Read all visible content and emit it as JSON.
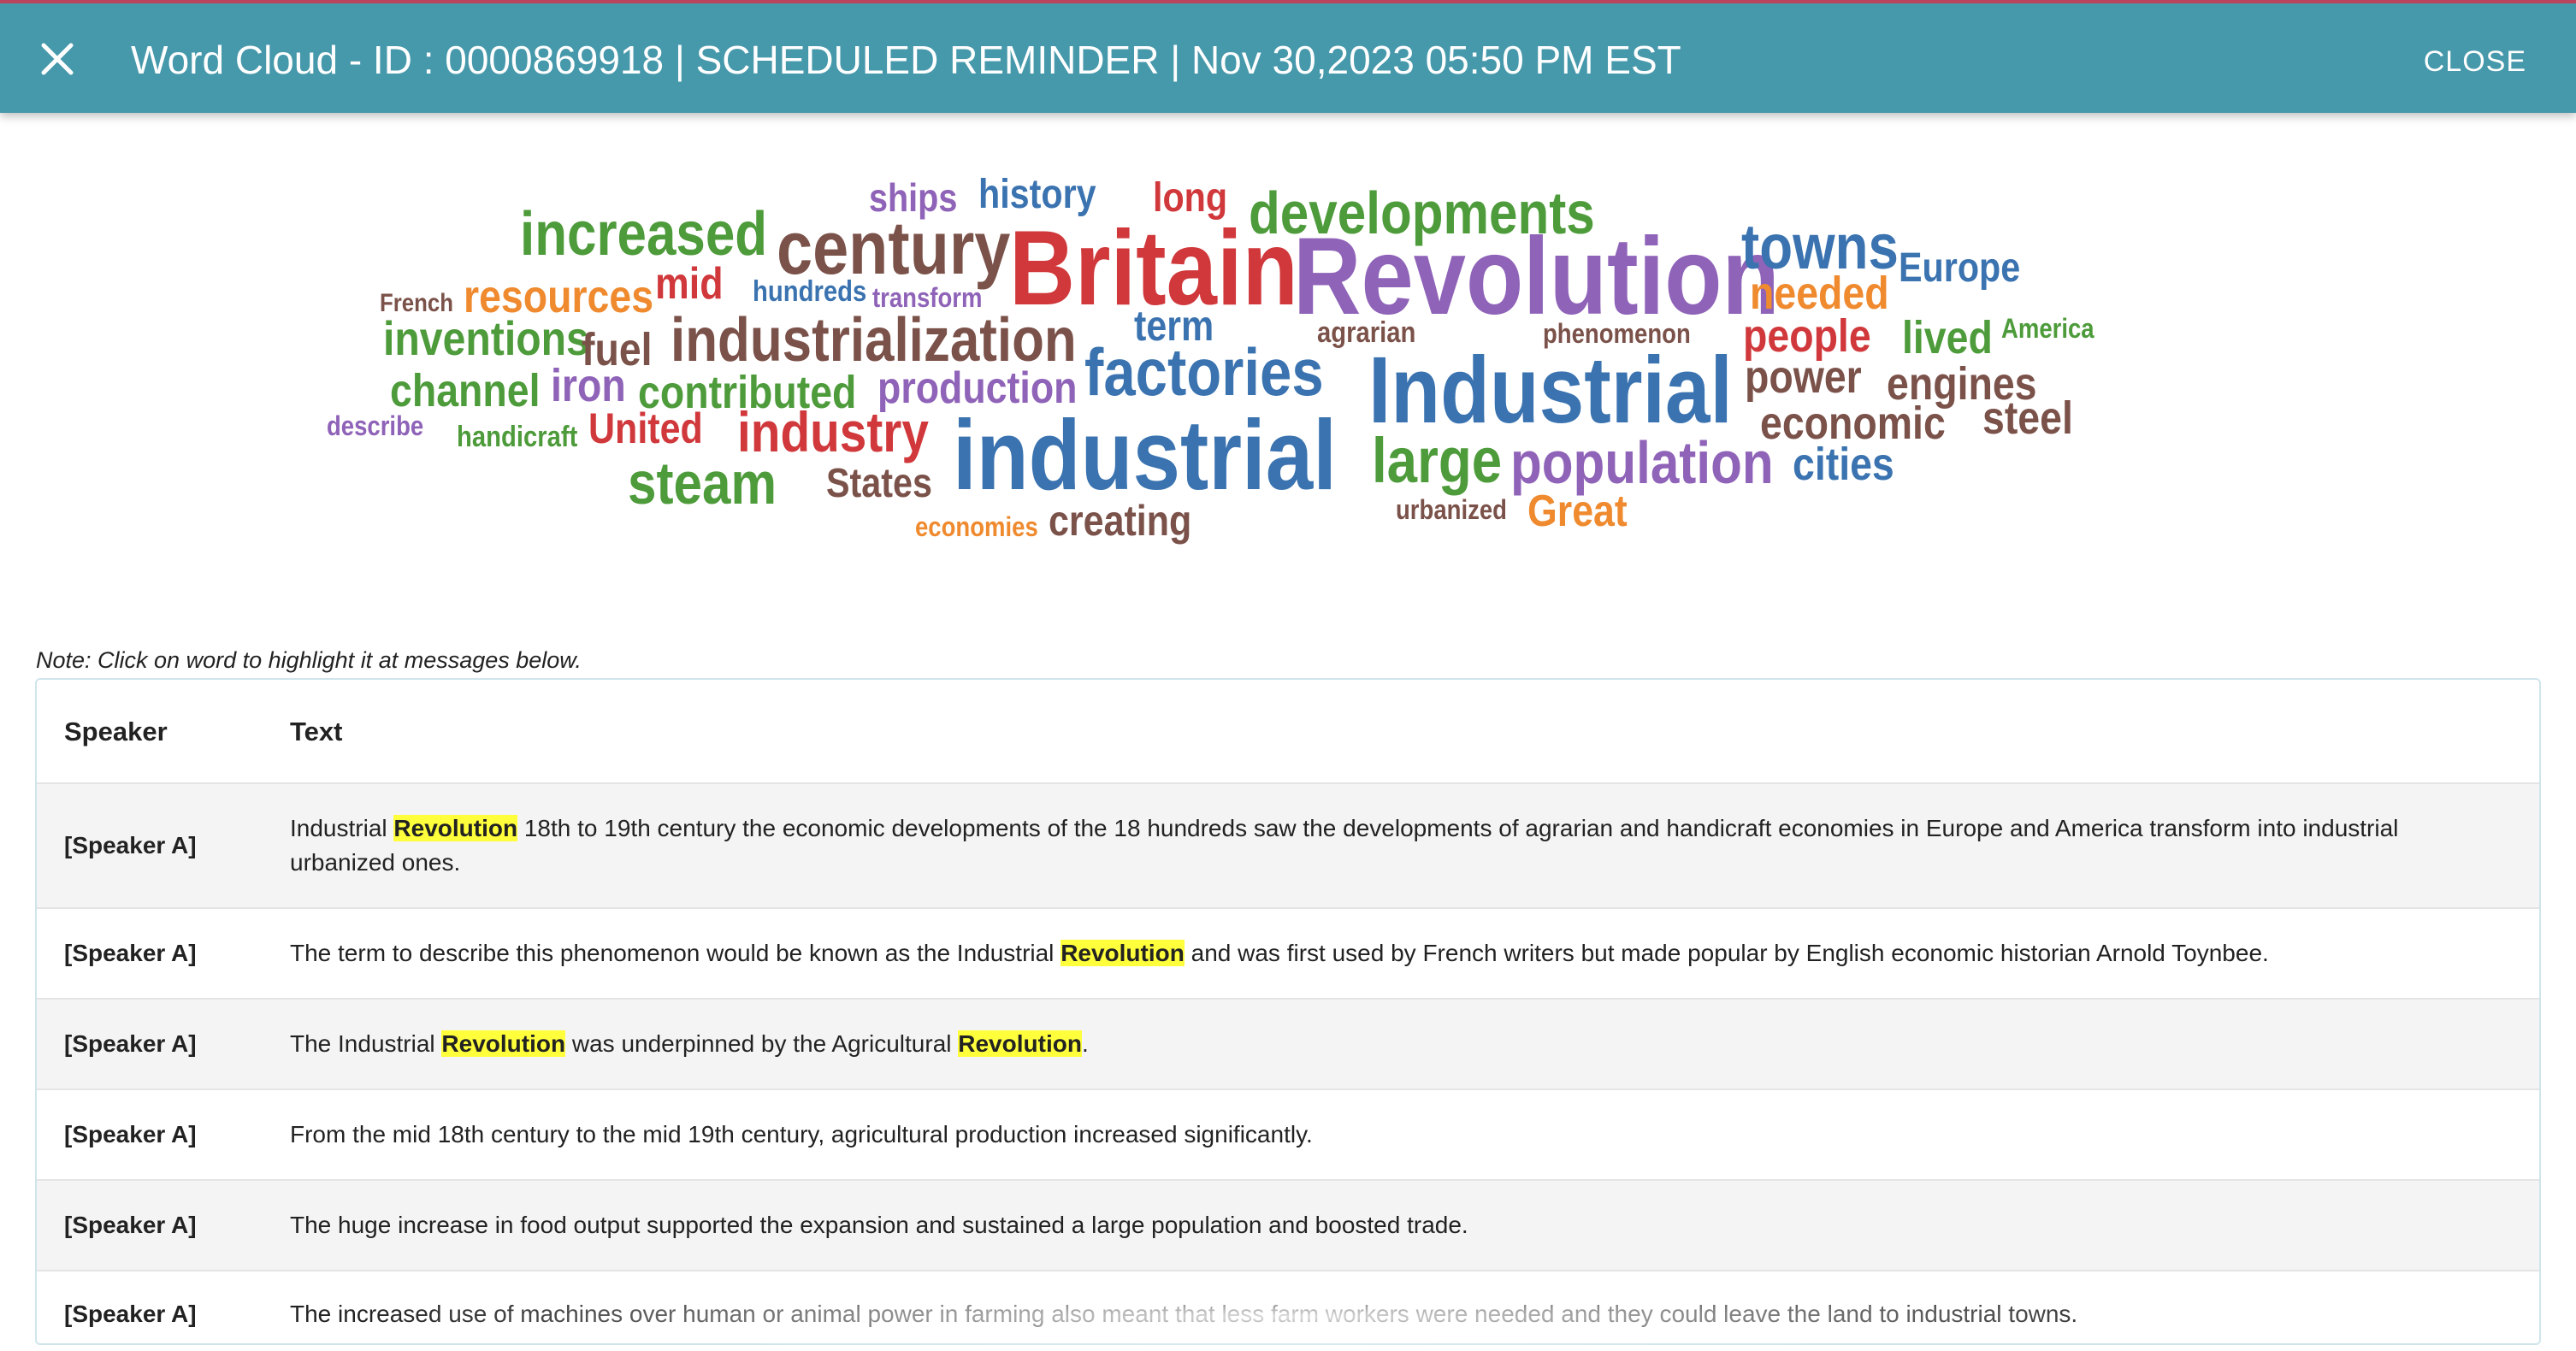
{
  "header": {
    "title": "Word Cloud - ID : 0000869918 | SCHEDULED REMINDER | Nov 30,2023 05:50 PM EST",
    "close_label": "CLOSE",
    "close_icon": "close-icon",
    "background": "#4698ab"
  },
  "word_cloud": {
    "colors": {
      "green": "#4d9b3a",
      "brown": "#7b524a",
      "red": "#d0383b",
      "purple": "#8f63b8",
      "blue": "#3a73b0",
      "orange": "#ef8a2f"
    },
    "words": [
      {
        "text": "ships",
        "color": "purple"
      },
      {
        "text": "history",
        "color": "blue"
      },
      {
        "text": "long",
        "color": "red"
      },
      {
        "text": "developments",
        "color": "green"
      },
      {
        "text": "increased",
        "color": "green"
      },
      {
        "text": "century",
        "color": "brown"
      },
      {
        "text": "Britain",
        "color": "red"
      },
      {
        "text": "Revolution",
        "color": "purple"
      },
      {
        "text": "towns",
        "color": "blue"
      },
      {
        "text": "Europe",
        "color": "blue"
      },
      {
        "text": "French",
        "color": "brown"
      },
      {
        "text": "resources",
        "color": "orange"
      },
      {
        "text": "mid",
        "color": "red"
      },
      {
        "text": "hundreds",
        "color": "blue"
      },
      {
        "text": "transform",
        "color": "purple"
      },
      {
        "text": "term",
        "color": "blue"
      },
      {
        "text": "needed",
        "color": "orange"
      },
      {
        "text": "inventions",
        "color": "green"
      },
      {
        "text": "fuel",
        "color": "brown"
      },
      {
        "text": "industrialization",
        "color": "brown"
      },
      {
        "text": "agrarian",
        "color": "brown"
      },
      {
        "text": "phenomenon",
        "color": "brown"
      },
      {
        "text": "people",
        "color": "red"
      },
      {
        "text": "lived",
        "color": "green"
      },
      {
        "text": "America",
        "color": "green"
      },
      {
        "text": "factories",
        "color": "blue"
      },
      {
        "text": "Industrial",
        "color": "blue"
      },
      {
        "text": "channel",
        "color": "green"
      },
      {
        "text": "iron",
        "color": "purple"
      },
      {
        "text": "contributed",
        "color": "green"
      },
      {
        "text": "production",
        "color": "purple"
      },
      {
        "text": "power",
        "color": "brown"
      },
      {
        "text": "engines",
        "color": "brown"
      },
      {
        "text": "describe",
        "color": "purple"
      },
      {
        "text": "handicraft",
        "color": "green"
      },
      {
        "text": "United",
        "color": "red"
      },
      {
        "text": "industry",
        "color": "red"
      },
      {
        "text": "industrial",
        "color": "blue"
      },
      {
        "text": "economic",
        "color": "brown"
      },
      {
        "text": "steel",
        "color": "brown"
      },
      {
        "text": "large",
        "color": "green"
      },
      {
        "text": "population",
        "color": "purple"
      },
      {
        "text": "cities",
        "color": "blue"
      },
      {
        "text": "steam",
        "color": "green"
      },
      {
        "text": "States",
        "color": "brown"
      },
      {
        "text": "urbanized",
        "color": "brown"
      },
      {
        "text": "Great",
        "color": "orange"
      },
      {
        "text": "economies",
        "color": "orange"
      },
      {
        "text": "creating",
        "color": "brown"
      }
    ]
  },
  "note": "Note: Click on word to highlight it at messages below.",
  "table": {
    "headers": {
      "speaker": "Speaker",
      "text": "Text"
    },
    "highlight_color": "#ffff3c",
    "rows": [
      {
        "speaker": "[Speaker A]",
        "segments": [
          {
            "text": "Industrial ",
            "hl": false
          },
          {
            "text": "Revolution",
            "hl": true
          },
          {
            "text": " 18th to 19th century the economic developments of the 18 hundreds saw the developments of agrarian and handicraft economies in Europe and America transform into industrial urbanized ones.",
            "hl": false
          }
        ]
      },
      {
        "speaker": "[Speaker A]",
        "segments": [
          {
            "text": "The term to describe this phenomenon would be known as the Industrial ",
            "hl": false
          },
          {
            "text": "Revolution",
            "hl": true
          },
          {
            "text": " and was first used by French writers but made popular by English economic historian Arnold Toynbee.",
            "hl": false
          }
        ]
      },
      {
        "speaker": "[Speaker A]",
        "segments": [
          {
            "text": "The Industrial ",
            "hl": false
          },
          {
            "text": "Revolution",
            "hl": true
          },
          {
            "text": " was underpinned by the Agricultural ",
            "hl": false
          },
          {
            "text": "Revolution",
            "hl": true
          },
          {
            "text": ".",
            "hl": false
          }
        ]
      },
      {
        "speaker": "[Speaker A]",
        "segments": [
          {
            "text": "From the mid 18th century to the mid 19th century, agricultural production increased significantly.",
            "hl": false
          }
        ]
      },
      {
        "speaker": "[Speaker A]",
        "segments": [
          {
            "text": "The huge increase in food output supported the expansion and sustained a large population and boosted trade.",
            "hl": false
          }
        ]
      },
      {
        "speaker": "[Speaker A]",
        "segments": [
          {
            "text": "The increased use of machines over human or animal power in farming also meant that less farm workers were needed and they could leave the land to industrial towns.",
            "hl": false
          }
        ]
      }
    ]
  }
}
